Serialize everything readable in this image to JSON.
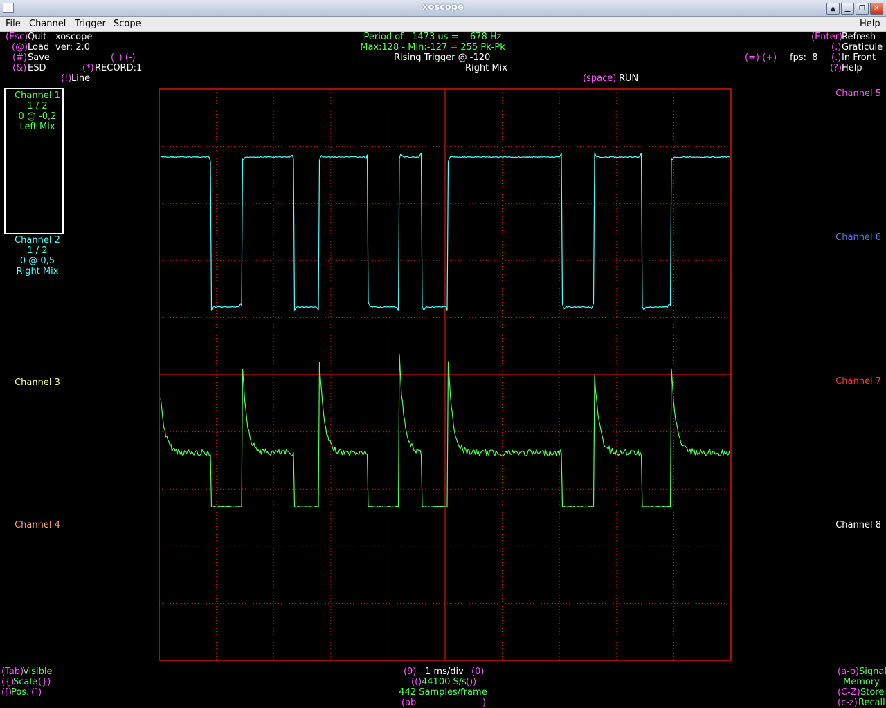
{
  "window": {
    "title": "xoscope"
  },
  "menu": [
    "File",
    "Channel",
    "Trigger",
    "Scope"
  ],
  "menu_help": "Help",
  "top_left": {
    "quit_key": "(Esc)",
    "quit_label": "Quit",
    "app_name": "xoscope",
    "load_key": "(@)",
    "load_label": "Load",
    "version": "ver: 2.0",
    "save_key": "(#)",
    "save_label": "Save",
    "scale_keys": "(_) (-)",
    "esd_key": "(&)",
    "esd_label": "ESD",
    "record_key": "(*)",
    "record_label": "RECORD:1",
    "line_key": "(!)",
    "line_label": "Line"
  },
  "measure": {
    "period": "Period of   1473 us =    678 Hz",
    "maxmin": "Max:128 - Min:-127 = 255 Pk-Pk",
    "trigger": "Rising Trigger @ -120",
    "trigger_source": "Right Mix",
    "run_key": "(space)",
    "run_label": "RUN"
  },
  "top_right": {
    "refresh_key": "(Enter)",
    "refresh_label": "Refresh",
    "graticule_key": "(.)",
    "graticule_label": "Graticule",
    "front_key": "(.)",
    "front_label": "In Front",
    "fps_keys": "(=) (+)",
    "fps": "fps:  8",
    "help_key": "(?)",
    "help_label": "Help"
  },
  "channels_left": [
    {
      "label": "Channel 1",
      "scale": "1 / 2",
      "pos": "0 @ -0,2",
      "source": "Left Mix",
      "color": "#55ff55"
    },
    {
      "label": "Channel 2",
      "scale": "1 / 2",
      "pos": "0 @ 0,5",
      "source": "Right Mix",
      "color": "#55ffff"
    },
    {
      "label": "Channel 3",
      "color": "#ffff99"
    },
    {
      "label": "Channel 4",
      "color": "#ffaa66"
    }
  ],
  "channels_right": [
    {
      "label": "Channel 5",
      "color": "#ff55ff"
    },
    {
      "label": "Channel 6",
      "color": "#5577ff"
    },
    {
      "label": "Channel 7",
      "color": "#ff3333"
    },
    {
      "label": "Channel 8",
      "color": "#ffffff"
    }
  ],
  "bottom_left": {
    "visible_key": "(Tab)",
    "visible_label": "Visible",
    "scale_open": "({)",
    "scale_label": "Scale",
    "scale_close": "(})",
    "pos_open": "([)",
    "pos_label": "Pos.",
    "pos_close": "(])"
  },
  "bottom_center": {
    "tb_dec": "(9)",
    "timebase": "1 ms/div",
    "tb_inc": "(0)",
    "rate_open": "(()",
    "rate": "44100 S/s",
    "rate_close": "())",
    "samples": "442 Samples/frame",
    "ab_open": "(ab",
    "ab_close": ")"
  },
  "bottom_right": {
    "signal_key": "(a-b)",
    "signal_label": "Signal",
    "memory_label": "Memory",
    "store_key": "(C-Z)",
    "store_label": "Store",
    "recall_key": "(c-z)",
    "recall_label": "Recall"
  },
  "colors": {
    "background": "#000000",
    "graticule": "#dd1111",
    "ch1": "#55ff55",
    "ch2": "#55ffff",
    "key": "#ff55ff"
  },
  "chart_data": {
    "type": "line",
    "title": "",
    "timebase": "1 ms/div",
    "divisions": {
      "x": 10,
      "y": 10
    },
    "trigger_level": -120,
    "edges_ms": [
      0.9,
      1.45,
      2.35,
      2.8,
      3.65,
      4.2,
      4.6,
      5.05,
      7.05,
      7.6,
      8.45,
      8.95
    ],
    "series": [
      {
        "name": "Channel 2",
        "color": "#55ffff",
        "kind": "square"
      },
      {
        "name": "Channel 1",
        "color": "#55ff55",
        "kind": "differentiated"
      }
    ]
  }
}
